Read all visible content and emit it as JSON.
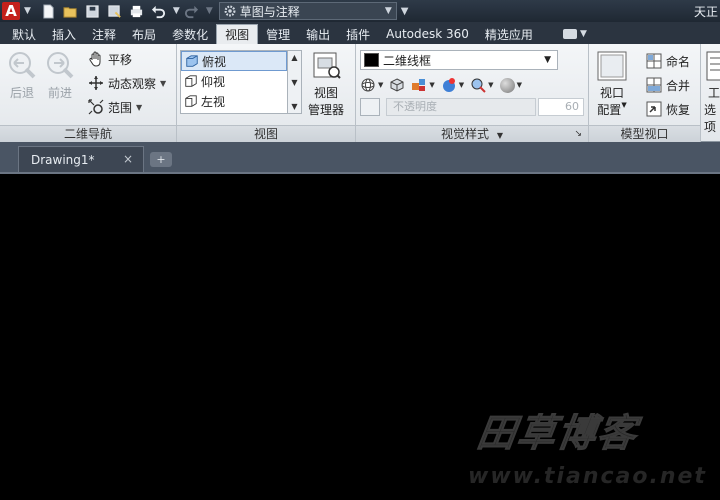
{
  "titlebar": {
    "logo_letter": "A",
    "workspace": "草图与注释",
    "right_text": "天正"
  },
  "ribbon_tabs": [
    "默认",
    "插入",
    "注释",
    "布局",
    "参数化",
    "视图",
    "管理",
    "输出",
    "插件",
    "Autodesk 360",
    "精选应用"
  ],
  "active_tab": "视图",
  "nav_panel": {
    "title": "二维导航",
    "back": "后退",
    "forward": "前进",
    "pan": "平移",
    "orbit": "动态观察",
    "extents": "范围"
  },
  "views_panel": {
    "title": "视图",
    "items": [
      "俯视",
      "仰视",
      "左视"
    ],
    "selected": "俯视",
    "manager_line1": "视图",
    "manager_line2": "管理器"
  },
  "visual_styles_panel": {
    "title": "视觉样式",
    "current_style": "二维线框",
    "opacity_label": "不透明度",
    "opacity_value": "60"
  },
  "model_viewports_panel": {
    "title": "模型视口",
    "config_line1": "视口",
    "config_line2": "配置",
    "named": "命名",
    "join": "合并",
    "restore": "恢复"
  },
  "extra_panel": {
    "line1": "工",
    "line2": "选项"
  },
  "doc_tabs": {
    "active": "Drawing1*",
    "close": "×",
    "add": "+"
  },
  "watermark": {
    "cn": "田草博客",
    "url": "www.tiancao.net"
  },
  "colors": {
    "accent_red": "#c4211c",
    "canvas_bg": "#000000",
    "titlebar_bg": "#2e3a48"
  }
}
